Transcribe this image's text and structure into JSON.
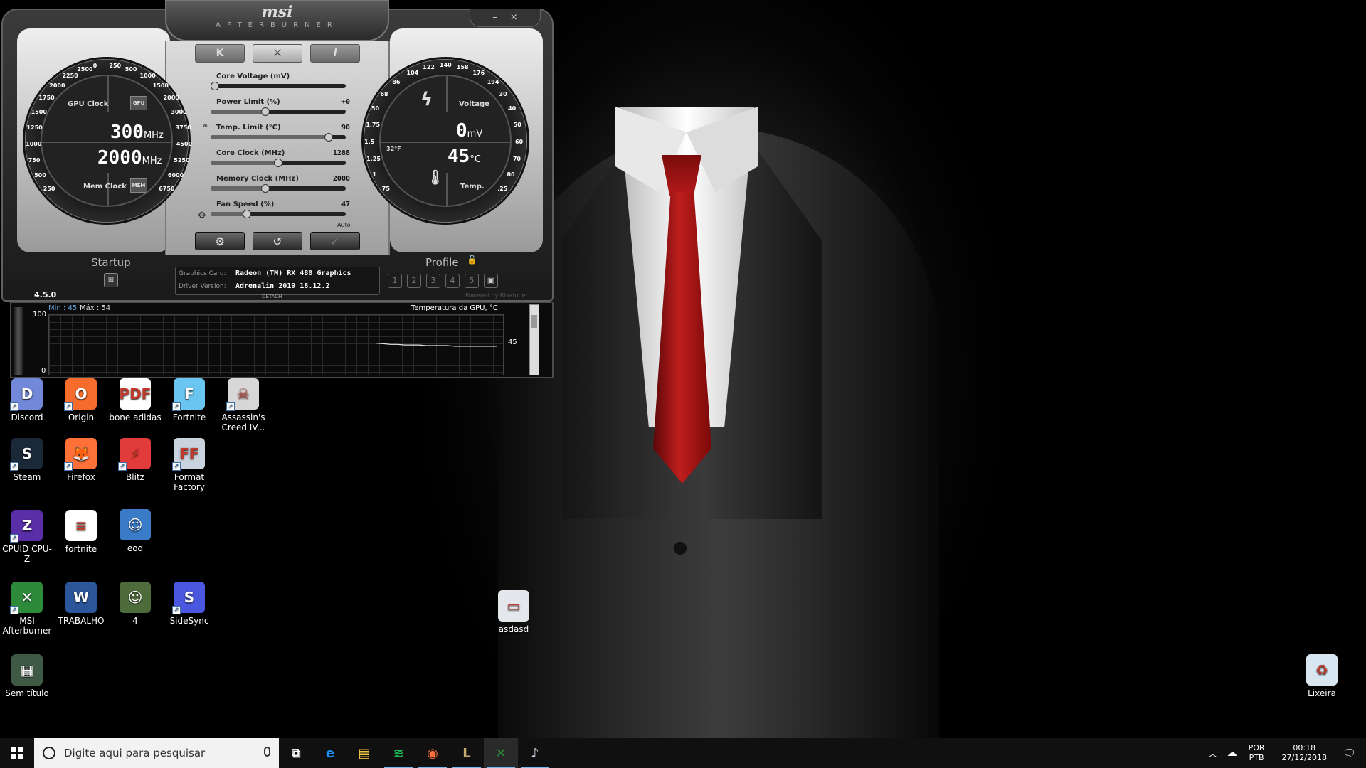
{
  "afterburner": {
    "logo": "msi",
    "subtitle": "AFTERBURNER",
    "win_minimize": "–",
    "win_close": "×",
    "tabs": [
      "K",
      "",
      "i"
    ],
    "version": "4.5.0",
    "gpu_gauge": {
      "gpu_label": "GPU Clock",
      "gpu_chip": "GPU",
      "gpu_value": "300",
      "gpu_unit": "MHz",
      "mem_value": "2000",
      "mem_unit": "MHz",
      "mem_label": "Mem Clock",
      "mem_chip": "MEM",
      "ticks": [
        "250",
        "500",
        "750",
        "1000",
        "1250",
        "1500",
        "1750",
        "2000",
        "2250",
        "2500",
        "0",
        "250",
        "500",
        "1000",
        "1500",
        "2000",
        "3000",
        "3750",
        "4500",
        "5250",
        "6000",
        "6750"
      ]
    },
    "volt_gauge": {
      "voltage_label": "Voltage",
      "voltage_value": "0",
      "voltage_unit": "mV",
      "temp_value": "45",
      "temp_unit": "°C",
      "temp_label": "Temp.",
      "f_mark": "32°F",
      "ticks": [
        "75",
        "1",
        "1.25",
        "1.5",
        "1.75",
        "50",
        "68",
        "86",
        "104",
        "122",
        "140",
        "158",
        "176",
        "194",
        "30",
        "40",
        "50",
        "60",
        "70",
        "80",
        ".25"
      ]
    },
    "sliders": [
      {
        "label": "Core Voltage (mV)",
        "value": ""
      },
      {
        "label": "Power Limit (%)",
        "value": "+0"
      },
      {
        "label": "Temp. Limit (°C)",
        "value": "90"
      },
      {
        "label": "Core Clock (MHz)",
        "value": "1288"
      },
      {
        "label": "Memory Clock (MHz)",
        "value": "2000"
      },
      {
        "label": "Fan Speed (%)",
        "value": "47"
      }
    ],
    "slider_levels": [
      0,
      0.4,
      0.9,
      0.5,
      0.4,
      0.25
    ],
    "fan_auto": "Auto",
    "buttons": {
      "settings": "⚙",
      "reset": "↺",
      "apply": "✓"
    },
    "startup_label": "Startup",
    "profile_label": "Profile",
    "profile_slots": [
      "1",
      "2",
      "3",
      "4",
      "5"
    ],
    "graphics_card_key": "Graphics Card:",
    "graphics_card_value": "Radeon (TM) RX 480 Graphics",
    "driver_key": "Driver Version:",
    "driver_value": "Adrenalin 2019 18.12.2",
    "detach": "DETACH",
    "powered_by": "Powered by Rivatuner",
    "graph": {
      "min_label": "Min : 45",
      "max_label": "Máx : 54",
      "title": "Temperatura da GPU, °C",
      "y_top": "100",
      "y_bottom": "0",
      "current_value": "45",
      "series": [
        54,
        53,
        52,
        52,
        51,
        51,
        51,
        50,
        50,
        50,
        50,
        49,
        49,
        49,
        49,
        49,
        49,
        49
      ]
    }
  },
  "desktop_icons": [
    {
      "label": "Discord",
      "icon": "discord-icon",
      "color": "#7289da",
      "glyph": "D"
    },
    {
      "label": "Origin",
      "icon": "origin-icon",
      "color": "#f56c2d",
      "glyph": "O"
    },
    {
      "label": "bone adidas",
      "icon": "pdf-icon",
      "color": "#ffffff",
      "glyph": "PDF"
    },
    {
      "label": "Fortnite",
      "icon": "fortnite-icon",
      "color": "#6ac6f0",
      "glyph": "F"
    },
    {
      "label": "Assassin's Creed IV...",
      "icon": "assassins-creed-icon",
      "color": "#d7d7d7",
      "glyph": "☠"
    },
    {
      "label": "Steam",
      "icon": "steam-icon",
      "color": "#1b2838",
      "glyph": "S"
    },
    {
      "label": "Firefox",
      "icon": "firefox-icon",
      "color": "#ff7139",
      "glyph": "🦊"
    },
    {
      "label": "Blitz",
      "icon": "blitz-icon",
      "color": "#e23b3b",
      "glyph": "⚡"
    },
    {
      "label": "Format Factory",
      "icon": "format-factory-icon",
      "color": "#c9d3dd",
      "glyph": "FF"
    },
    {
      "label": "CPUID CPU-Z",
      "icon": "cpuz-icon",
      "color": "#5a2ea6",
      "glyph": "Z"
    },
    {
      "label": "fortnite",
      "icon": "text-file-icon",
      "color": "#ffffff",
      "glyph": "≡"
    },
    {
      "label": "eoq",
      "icon": "photo-icon",
      "color": "#3a7bc8",
      "glyph": "☺"
    },
    {
      "label": "MSI Afterburner",
      "icon": "msi-afterburner-icon",
      "color": "#2d8a3a",
      "glyph": "✕"
    },
    {
      "label": "TRABALHO",
      "icon": "word-doc-icon",
      "color": "#2b579a",
      "glyph": "W"
    },
    {
      "label": "4",
      "icon": "photo-icon",
      "color": "#4d6b3b",
      "glyph": "☺"
    },
    {
      "label": "SideSync",
      "icon": "sidesync-icon",
      "color": "#4a58e0",
      "glyph": "S"
    },
    {
      "label": "Sem título",
      "icon": "image-file-icon",
      "color": "#3f5a44",
      "glyph": "▦"
    },
    {
      "label": "asdasd",
      "icon": "image-file-icon",
      "color": "#e4e8ec",
      "glyph": "▭"
    },
    {
      "label": "Lixeira",
      "icon": "recycle-bin-icon",
      "color": "#d8e6f2",
      "glyph": "♻"
    }
  ],
  "taskbar": {
    "search_placeholder": "Digite aqui para pesquisar",
    "apps": [
      {
        "name": "task-view",
        "icon": "task-view-icon",
        "color": "#ffffff",
        "glyph": "⧉"
      },
      {
        "name": "edge",
        "icon": "edge-icon",
        "color": "#1e90ff",
        "glyph": "e"
      },
      {
        "name": "file-explorer",
        "icon": "folder-icon",
        "color": "#f4c542",
        "glyph": "▤"
      },
      {
        "name": "spotify",
        "icon": "spotify-icon",
        "color": "#1db954",
        "glyph": "≋"
      },
      {
        "name": "firefox",
        "icon": "firefox-icon",
        "color": "#ff7139",
        "glyph": "◉"
      },
      {
        "name": "league",
        "icon": "league-icon",
        "color": "#c8aa6e",
        "glyph": "L"
      },
      {
        "name": "msi-afterburner",
        "icon": "msi-afterburner-icon",
        "color": "#2d8a3a",
        "glyph": "✕"
      },
      {
        "name": "format-factory",
        "icon": "format-factory-icon",
        "color": "#c9d3dd",
        "glyph": "♪"
      }
    ],
    "lang_top": "POR",
    "lang_bottom": "PTB",
    "time": "00:18",
    "date": "27/12/2018"
  }
}
